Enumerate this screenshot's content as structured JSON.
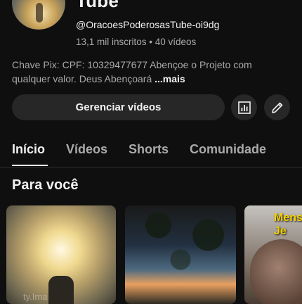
{
  "channel": {
    "title": "Tube",
    "handle": "@OracoesPoderosasTube-oi9dg",
    "stats": "13,1 mil inscritos • 40 vídeos",
    "description": "Chave Pix: CPF: 10329477677 Abençoe o Projeto com qualquer valor. Deus Abençoará",
    "more_label": "...mais"
  },
  "actions": {
    "manage_label": "Gerenciar vídeos",
    "analytics_icon": "analytics-icon",
    "edit_icon": "pencil-icon"
  },
  "tabs": [
    {
      "label": "Início",
      "active": true
    },
    {
      "label": "Vídeos",
      "active": false
    },
    {
      "label": "Shorts",
      "active": false
    },
    {
      "label": "Comunidade",
      "active": false
    }
  ],
  "section": {
    "title": "Para você"
  },
  "thumbnails": [
    {
      "watermark": "ty.Ima"
    },
    {},
    {
      "caption": "Mens o Je"
    }
  ],
  "colors": {
    "background": "#0f0f0f",
    "button": "#272727",
    "secondary_text": "#aaaaaa",
    "primary_text": "#f1f1f1"
  }
}
